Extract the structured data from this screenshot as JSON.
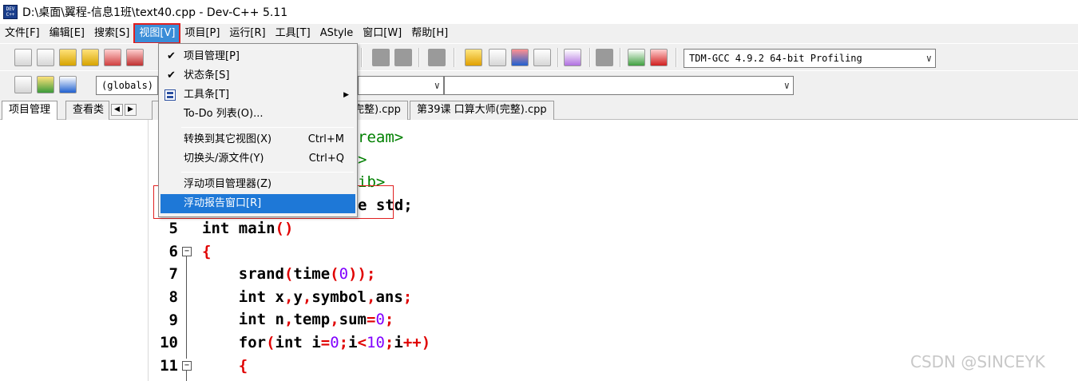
{
  "window": {
    "title": "D:\\桌面\\翼程-信息1班\\text40.cpp - Dev-C++ 5.11"
  },
  "menubar": {
    "items": [
      "文件[F]",
      "编辑[E]",
      "搜索[S]",
      "视图[V]",
      "项目[P]",
      "运行[R]",
      "工具[T]",
      "AStyle",
      "窗口[W]",
      "帮助[H]"
    ],
    "active_index": 3
  },
  "toolbar": {
    "compiler": "TDM-GCC 4.9.2 64-bit Profiling",
    "scope_combo": "(globals)"
  },
  "left_tabs": {
    "project_tab": "项目管理",
    "class_tab": "查看类"
  },
  "editor_tabs": {
    "tab1": "完整).cpp",
    "tab2": "第39课 口算大师(完整).cpp"
  },
  "view_menu": {
    "items": [
      {
        "label": "项目管理[P]",
        "checked": true
      },
      {
        "label": "状态条[S]",
        "checked": true
      },
      {
        "label": "工具条[T]",
        "submenu": true
      },
      {
        "label": "To-Do 列表(O)..."
      },
      {
        "label": "转换到其它视图(X)",
        "shortcut": "Ctrl+M"
      },
      {
        "label": "切换头/源文件(Y)",
        "shortcut": "Ctrl+Q"
      },
      {
        "label": "浮动项目管理器(Z)"
      },
      {
        "label": "浮动报告窗口[R]",
        "highlighted": true
      }
    ]
  },
  "code": {
    "line_numbers": [
      "5",
      "6",
      "7",
      "8",
      "9",
      "10",
      "11"
    ],
    "partial_lines": [
      "ream>",
      ">",
      "ib>",
      "e std;"
    ],
    "lines": [
      "int main()",
      "{",
      "    srand(time(0));",
      "    int x,y,symbol,ans;",
      "    int n,temp,sum=0;",
      "    for(int i=0;i<10;i++)",
      "    {"
    ]
  },
  "watermark": "CSDN @SINCEYK",
  "colors": {
    "menu_active": "#3a8dd8",
    "highlight": "#1e78d7",
    "annotation_red": "#e02020",
    "preprocessor": "#008000",
    "number": "#8000ff",
    "bracket": "#e00000"
  }
}
